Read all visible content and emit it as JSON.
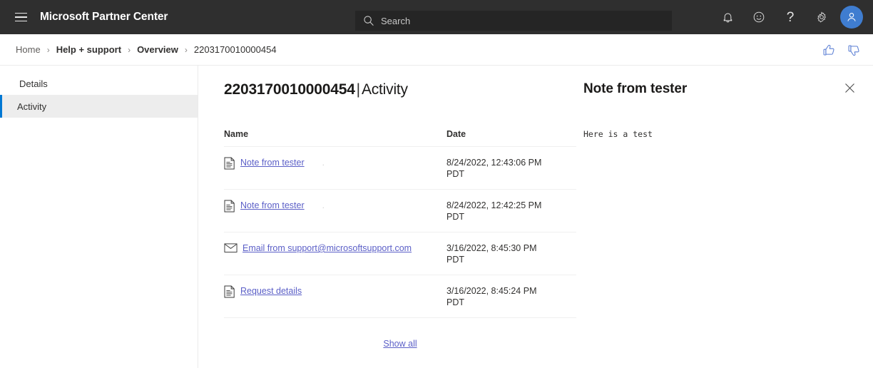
{
  "header": {
    "menu_icon": "hamburger-icon",
    "brand": "Microsoft Partner Center",
    "search": {
      "icon": "search-icon",
      "placeholder": "Search",
      "value": ""
    },
    "actions": [
      {
        "name": "notifications",
        "icon": "bell-icon"
      },
      {
        "name": "feedback-smiley",
        "icon": "smiley-icon"
      },
      {
        "name": "help",
        "icon": "question-mark-icon",
        "glyph": "?"
      },
      {
        "name": "settings",
        "icon": "gear-icon"
      },
      {
        "name": "account",
        "icon": "person-avatar-icon"
      }
    ],
    "background": "#2f2f2f",
    "search_background": "#252525"
  },
  "breadcrumb": {
    "separator": "›",
    "items": [
      {
        "label": "Home",
        "bold": false,
        "current": false
      },
      {
        "label": "Help + support",
        "bold": true,
        "current": false
      },
      {
        "label": "Overview",
        "bold": true,
        "current": false
      },
      {
        "label": "2203170010000454",
        "bold": false,
        "current": true
      }
    ],
    "feedback": [
      {
        "name": "thumbs-up",
        "icon": "thumbs-up-icon"
      },
      {
        "name": "thumbs-down",
        "icon": "thumbs-down-icon"
      }
    ],
    "feedback_color": "#5b7fd4"
  },
  "sidebar": {
    "items": [
      {
        "label": "Details",
        "selected": false
      },
      {
        "label": "Activity",
        "selected": true
      }
    ],
    "selected_accent": "#0078d4",
    "selected_background": "#ededed"
  },
  "main": {
    "title_id": "2203170010000454",
    "title_separator": "|",
    "title_section": "Activity",
    "table": {
      "columns": [
        "Name",
        "Date"
      ],
      "rows": [
        {
          "icon": "document-icon",
          "name": "Note from tester",
          "trailing_mark": ".",
          "date": "8/24/2022, 12:43:06 PM",
          "timezone": "PDT"
        },
        {
          "icon": "document-icon",
          "name": "Note from tester",
          "trailing_mark": ".",
          "date": "8/24/2022, 12:42:25 PM",
          "timezone": "PDT"
        },
        {
          "icon": "envelope-icon",
          "name": "Email from support@microsoftsupport.com",
          "trailing_mark": "",
          "date": "3/16/2022, 8:45:30 PM",
          "timezone": "PDT"
        },
        {
          "icon": "document-icon",
          "name": "Request details",
          "trailing_mark": "",
          "date": "3/16/2022, 8:45:24 PM",
          "timezone": "PDT"
        }
      ]
    },
    "show_all_label": "Show all",
    "link_color": "#5b5fc7"
  },
  "detail_panel": {
    "title": "Note from tester",
    "body": "Here is a test",
    "close_icon": "close-x-icon"
  }
}
